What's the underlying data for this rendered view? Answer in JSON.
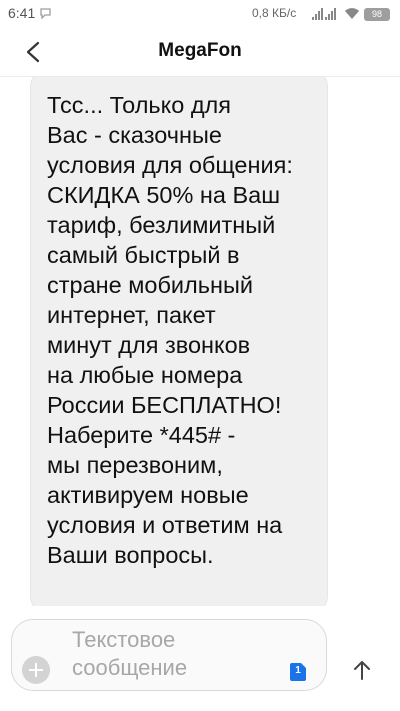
{
  "status_bar": {
    "time": "6:41",
    "network_speed": "0,8 КБ/с",
    "battery": "98",
    "icons": [
      "chat-notification-icon",
      "signal-icon",
      "signal-icon",
      "wifi-icon",
      "battery-icon"
    ]
  },
  "header": {
    "title": "MegaFon",
    "back_icon": "back-arrow-icon"
  },
  "message": {
    "text": "Тсс... Только для\nВас - сказочные\nусловия для общения:\nСКИДКА 50% на Ваш\nтариф, безлимитный\nсамый быстрый в\nстране мобильный\nинтернет, пакет\nминут для звонков\nна любые номера\nРоссии БЕСПЛАТНО!\nНаберите *445# -\nмы перезвоним,\nактивируем новые\nусловия и ответим на\nВаши вопросы."
  },
  "composer": {
    "placeholder": "Текстовое сообщение",
    "value": "",
    "sim_slot": "1",
    "add_icon": "add-icon",
    "send_icon": "send-arrow-icon"
  },
  "colors": {
    "bubble": "#f0f0f0",
    "sim_badge": "#1a73e8",
    "header_title": "#111111"
  }
}
